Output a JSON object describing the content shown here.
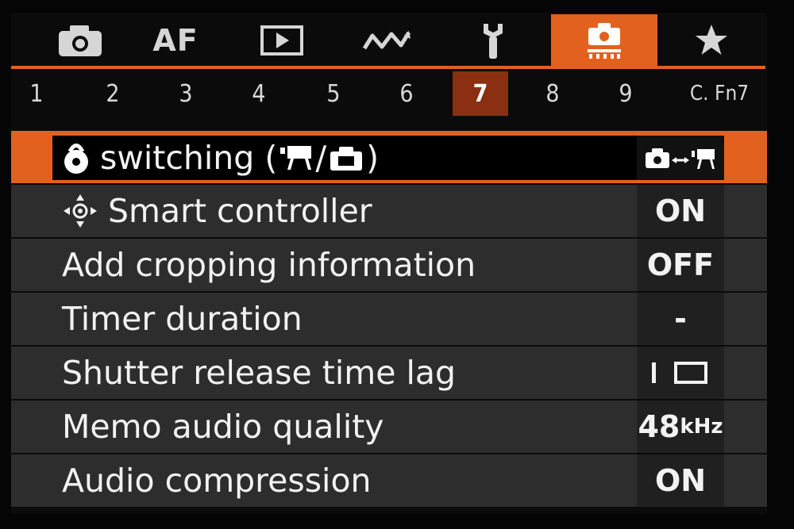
{
  "tabs": {
    "items": [
      {
        "name": "shooting",
        "icon": "camera-icon"
      },
      {
        "name": "af",
        "label": "AF"
      },
      {
        "name": "playback",
        "icon": "playback-icon"
      },
      {
        "name": "wireless",
        "icon": "wireless-icon"
      },
      {
        "name": "setup",
        "icon": "wrench-icon"
      },
      {
        "name": "custom-functions",
        "icon": "custom-functions-icon",
        "active": true
      },
      {
        "name": "my-menu",
        "icon": "star-icon"
      }
    ],
    "accent": "#e2611f"
  },
  "pages": {
    "items": [
      "1",
      "2",
      "3",
      "4",
      "5",
      "6",
      "7",
      "8",
      "9",
      "C. Fn7"
    ],
    "active_index": 6,
    "active_color": "#8a2f12"
  },
  "menu": {
    "rows": [
      {
        "label": "switching (",
        "label_suffix": ")",
        "icon": "lock-icon",
        "value_icon": "photo-video-switch-icon",
        "selected": true
      },
      {
        "label": "Smart controller",
        "icon": "smart-controller-icon",
        "value": "ON"
      },
      {
        "label": "Add cropping information",
        "value": "OFF"
      },
      {
        "label": "Timer duration",
        "value": "-"
      },
      {
        "label": "Shutter release time lag",
        "value_icon": "time-lag-icon"
      },
      {
        "label": "Memo audio quality",
        "value": "48",
        "value_unit": "kHz"
      },
      {
        "label": "Audio compression",
        "value": "ON"
      }
    ]
  }
}
